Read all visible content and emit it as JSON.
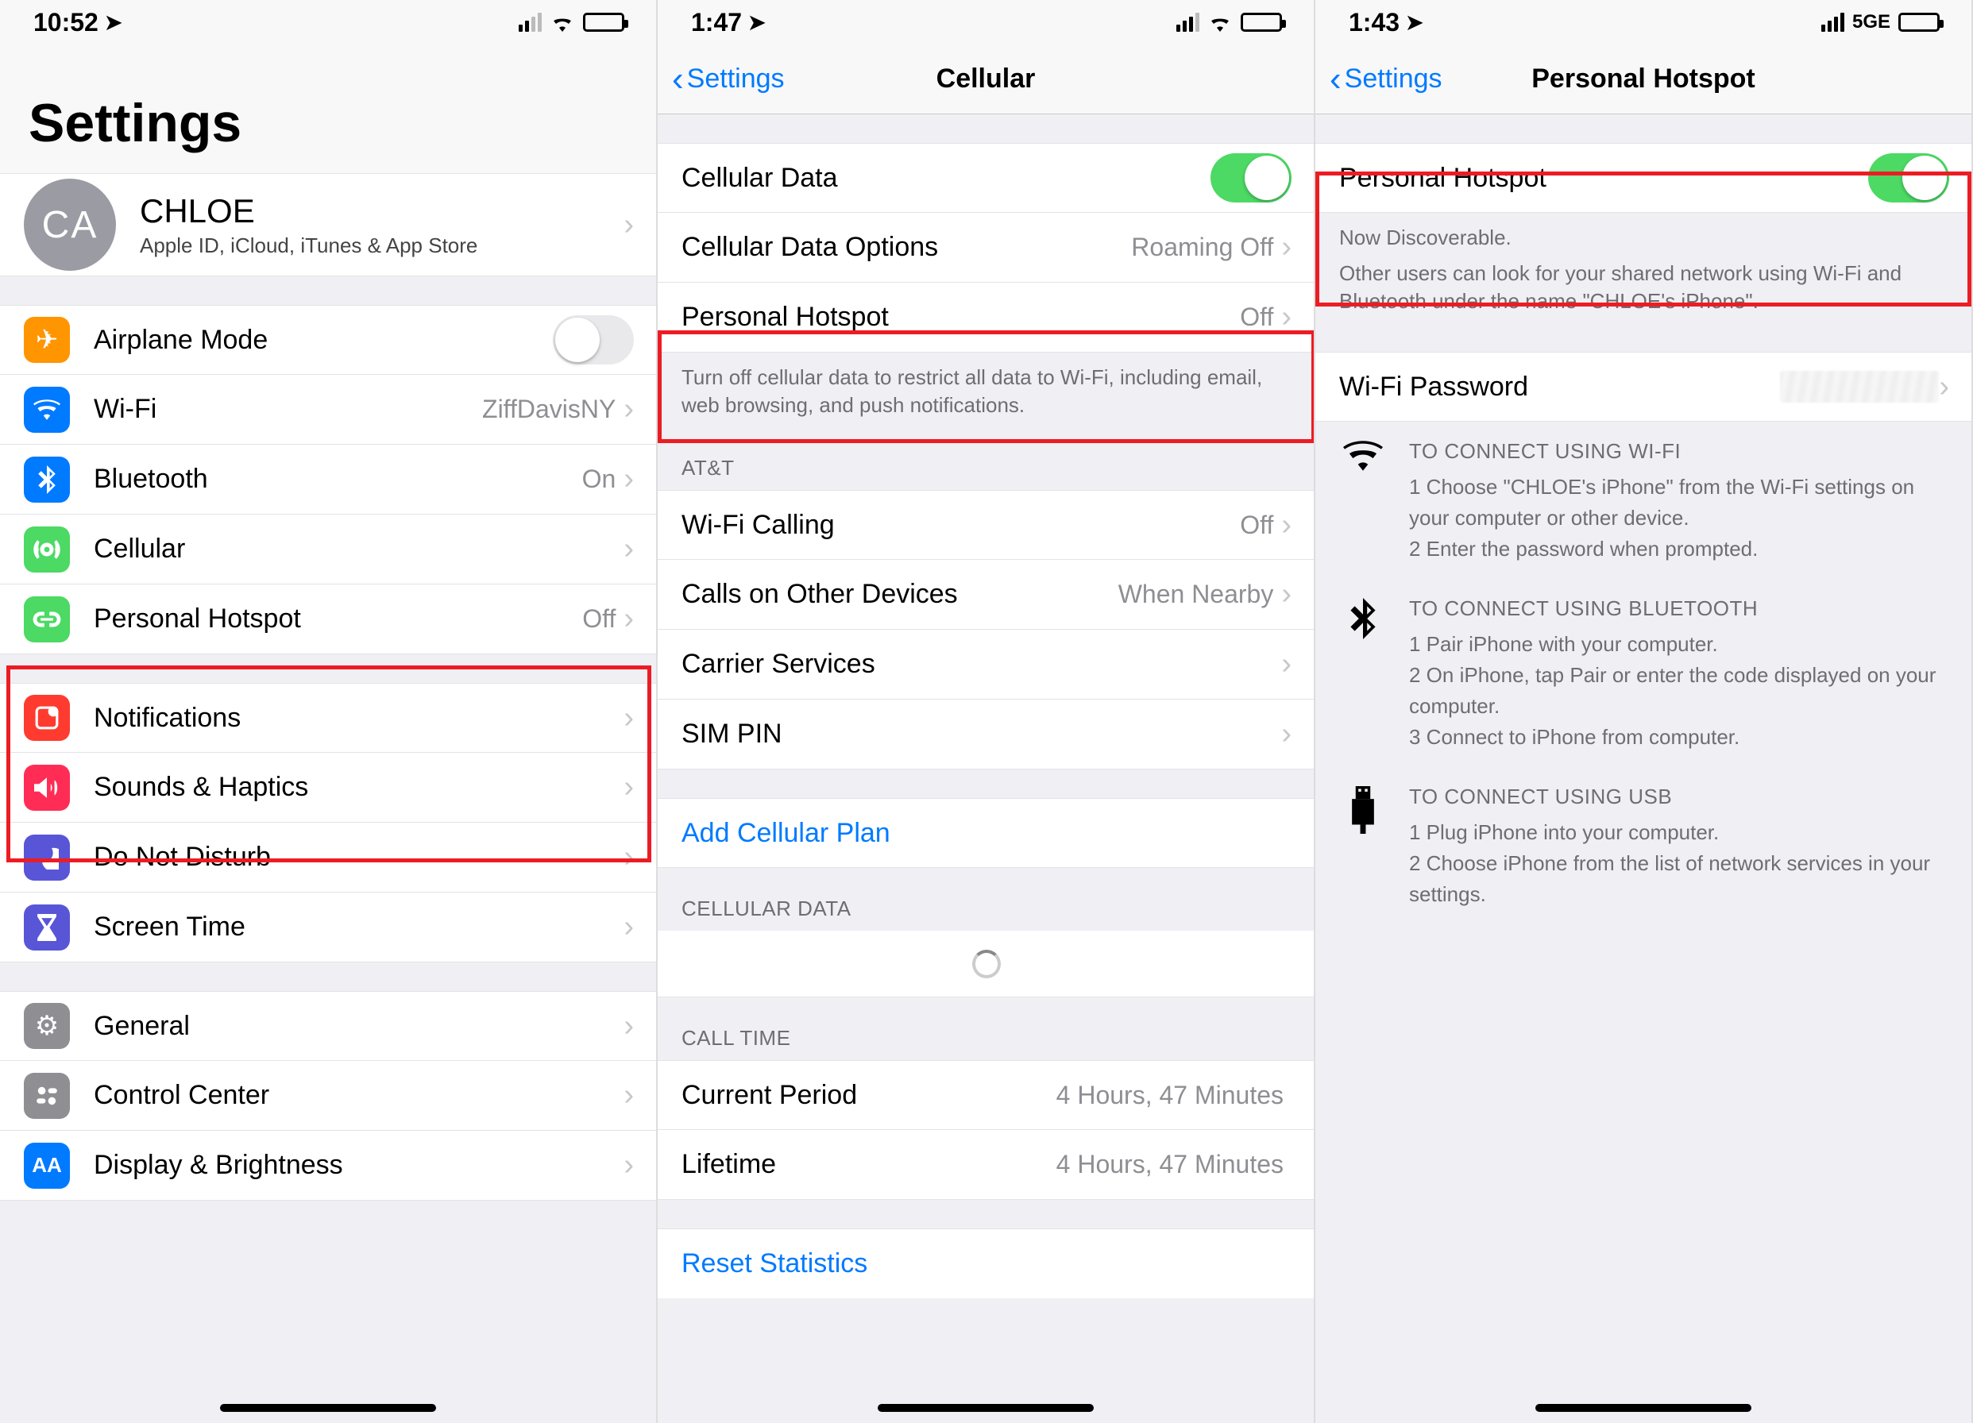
{
  "panel1": {
    "status": {
      "time": "10:52",
      "network": "",
      "signal": 2
    },
    "title": "Settings",
    "profile": {
      "initials": "CA",
      "name": "CHLOE",
      "sub": "Apple ID, iCloud, iTunes & App Store"
    },
    "rows1": [
      {
        "icon": "airplane",
        "label": "Airplane Mode",
        "type": "toggle",
        "on": false
      },
      {
        "icon": "wifi",
        "label": "Wi-Fi",
        "value": "ZiffDavisNY",
        "type": "nav"
      },
      {
        "icon": "bluetooth",
        "label": "Bluetooth",
        "value": "On",
        "type": "nav"
      },
      {
        "icon": "cellular",
        "label": "Cellular",
        "value": "",
        "type": "nav"
      },
      {
        "icon": "hotspot",
        "label": "Personal Hotspot",
        "value": "Off",
        "type": "nav"
      }
    ],
    "rows2": [
      {
        "icon": "notifications",
        "label": "Notifications",
        "type": "nav"
      },
      {
        "icon": "sounds",
        "label": "Sounds & Haptics",
        "type": "nav"
      },
      {
        "icon": "dnd",
        "label": "Do Not Disturb",
        "type": "nav"
      },
      {
        "icon": "screentime",
        "label": "Screen Time",
        "type": "nav"
      }
    ],
    "rows3": [
      {
        "icon": "general",
        "label": "General",
        "type": "nav"
      },
      {
        "icon": "control",
        "label": "Control Center",
        "type": "nav"
      },
      {
        "icon": "display",
        "label": "Display & Brightness",
        "type": "nav"
      }
    ]
  },
  "panel2": {
    "status": {
      "time": "1:47",
      "signal": 3
    },
    "back": "Settings",
    "title": "Cellular",
    "rows1": [
      {
        "label": "Cellular Data",
        "type": "toggle",
        "on": true
      },
      {
        "label": "Cellular Data Options",
        "value": "Roaming Off",
        "type": "nav"
      },
      {
        "label": "Personal Hotspot",
        "value": "Off",
        "type": "nav"
      }
    ],
    "footer1": "Turn off cellular data to restrict all data to Wi-Fi, including email, web browsing, and push notifications.",
    "header2": "AT&T",
    "rows2": [
      {
        "label": "Wi-Fi Calling",
        "value": "Off",
        "type": "nav"
      },
      {
        "label": "Calls on Other Devices",
        "value": "When Nearby",
        "type": "nav"
      },
      {
        "label": "Carrier Services",
        "type": "nav"
      },
      {
        "label": "SIM PIN",
        "type": "nav"
      }
    ],
    "link1": "Add Cellular Plan",
    "header3": "CELLULAR DATA",
    "header4": "CALL TIME",
    "rows3": [
      {
        "label": "Current Period",
        "value": "4 Hours, 47 Minutes"
      },
      {
        "label": "Lifetime",
        "value": "4 Hours, 47 Minutes"
      }
    ],
    "link2": "Reset Statistics"
  },
  "panel3": {
    "status": {
      "time": "1:43",
      "network": "5GE",
      "signal": 4
    },
    "back": "Settings",
    "title": "Personal Hotspot",
    "toggle_label": "Personal Hotspot",
    "discoverable": "Now Discoverable.",
    "desc": "Other users can look for your shared network using Wi-Fi and Bluetooth under the name \"CHLOE's iPhone\".",
    "wifi_pw_label": "Wi-Fi Password",
    "instructions": [
      {
        "icon": "wifi",
        "title": "TO CONNECT USING WI-FI",
        "steps": [
          "1 Choose \"CHLOE's iPhone\" from the Wi-Fi settings on your computer or other device.",
          "2 Enter the password when prompted."
        ]
      },
      {
        "icon": "bluetooth",
        "title": "TO CONNECT USING BLUETOOTH",
        "steps": [
          "1 Pair iPhone with your computer.",
          "2 On iPhone, tap Pair or enter the code displayed on your computer.",
          "3 Connect to iPhone from computer."
        ]
      },
      {
        "icon": "usb",
        "title": "TO CONNECT USING USB",
        "steps": [
          "1 Plug iPhone into your computer.",
          "2 Choose iPhone from the list of network services in your settings."
        ]
      }
    ]
  }
}
